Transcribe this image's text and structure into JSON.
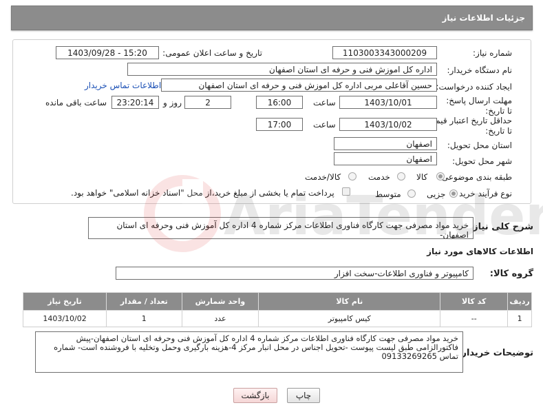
{
  "header": {
    "title": "جزئیات اطلاعات نیاز"
  },
  "form": {
    "need_number_label": "شماره نیاز:",
    "need_number": "1103003343000209",
    "announce_label": "تاریخ و ساعت اعلان عمومی:",
    "announce_value": "1403/09/28 - 15:20",
    "buyer_org_label": "نام دستگاه خریدار:",
    "buyer_org": "اداره کل اموزش فنی و حرفه ای استان اصفهان",
    "creator_label": "ایجاد کننده درخواست:",
    "creator": "حسین آقاعلی مربی اداره کل اموزش فنی و حرفه ای استان اصفهان",
    "contact_link": "اطلاعات تماس خریدار",
    "deadline_label": "مهلت ارسال پاسخ: تا تاریخ:",
    "deadline_date": "1403/10/01",
    "time_label": "ساعت",
    "deadline_time": "16:00",
    "days_value": "2",
    "days_label": "روز و",
    "remaining_time": "23:20:14",
    "remaining_label": "ساعت باقی مانده",
    "validity_label": "حداقل تاریخ اعتبار قیمت: تا تاریخ:",
    "validity_date": "1403/10/02",
    "validity_time": "17:00",
    "province_label": "استان محل تحویل:",
    "province": "اصفهان",
    "city_label": "شهر محل تحویل:",
    "city": "اصفهان",
    "category_label": "طبقه بندی موضوعی:",
    "category_options": [
      "کالا",
      "خدمت",
      "کالا/خدمت"
    ],
    "purchase_type_label": "نوع فرآیند خرید :",
    "purchase_options": [
      "جزیی",
      "متوسط"
    ],
    "payment_note": "پرداخت تمام یا بخشی از مبلغ خرید،از محل \"اسناد خزانه اسلامی\" خواهد بود."
  },
  "summary": {
    "label": "شرح کلی نیاز:",
    "text": "خرید مواد مصرفی جهت کارگاه فناوری اطلاعات مرکز شماره 4 اداره کل آموزش فنی وحرفه ای استان اصفهان-"
  },
  "goods": {
    "section_title": "اطلاعات کالاهای مورد نیاز",
    "group_label": "گروه کالا:",
    "group_value": "کامپیوتر و فناوری اطلاعات-سخت افزار",
    "columns": [
      "ردیف",
      "کد کالا",
      "نام کالا",
      "واحد شمارش",
      "تعداد / مقدار",
      "تاریخ نیاز"
    ],
    "rows": [
      {
        "index": "1",
        "code": "--",
        "name": "کیس کامپیوتر",
        "unit": "عدد",
        "qty": "1",
        "date": "1403/10/02"
      }
    ]
  },
  "buyer_notes": {
    "label": "توضیحات خریدار:",
    "text": "خرید مواد مصرفی جهت کارگاه فناوری اطلاعات مرکز شماره 4 اداره کل آموزش فنی وحرفه ای استان اصفهان-پیش فاکتورالزامی طبق لیست پیوست -تحویل اجناس در محل انبار مرکز 4-هزینه بارگیری وحمل وتخلیه با فروشنده است- شماره تماس 09133269265"
  },
  "buttons": {
    "print": "چاپ",
    "back": "بازگشت"
  },
  "watermark": {
    "text": "AriaTender.neT"
  },
  "colors": {
    "header_bg": "#8c8c8c",
    "link": "#1a4fb5",
    "back_button": "#f5d6d6"
  }
}
